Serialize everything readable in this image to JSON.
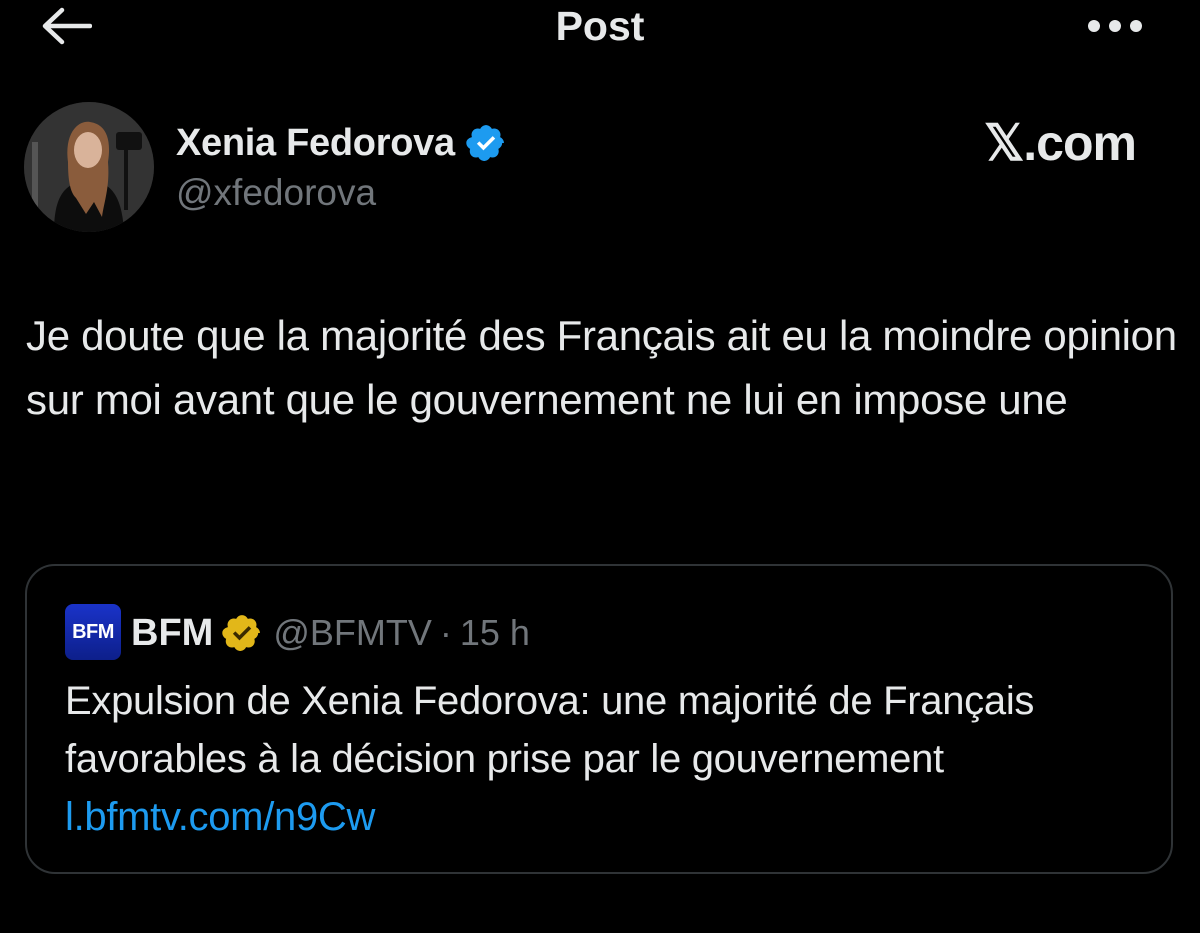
{
  "header": {
    "title": "Post",
    "back_icon": "arrow-left-icon",
    "more_icon": "more-horizontal-icon"
  },
  "author": {
    "display_name": "Xenia Fedorova",
    "handle": "@xfedorova",
    "verified": true,
    "verified_color": "#1d9bf0"
  },
  "watermark": "𝕏.com",
  "post": {
    "text": "Je doute que la majorité des Français ait eu la moindre opinion sur moi avant que le gouvernement ne lui en impose une"
  },
  "quote": {
    "logo_text": "BFM",
    "display_name": "BFM",
    "badge_color": "#e2b719",
    "handle": "@BFMTV",
    "separator": "·",
    "time": "15 h",
    "text": "Expulsion de Xenia Fedorova: une majorité de Français favorables à la décision prise par le gouvernement",
    "link": "l.bfmtv.com/n9Cw",
    "link_color": "#1d9bf0"
  },
  "colors": {
    "background": "#000000",
    "text_primary": "#e7e9ea",
    "text_secondary": "#71767b",
    "border": "#2f3336"
  }
}
